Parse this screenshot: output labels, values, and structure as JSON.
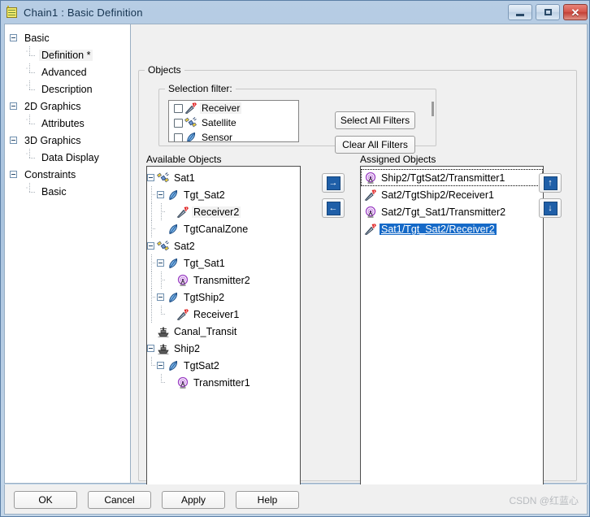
{
  "window": {
    "title": "Chain1 : Basic Definition",
    "icon": "clipboard-icon",
    "minimize_label": "Minimize",
    "maximize_label": "Maximize",
    "close_label": "✕"
  },
  "nav": {
    "items": [
      {
        "label": "Basic",
        "level": 0,
        "expander": true,
        "selected": false
      },
      {
        "label": "Definition *",
        "level": 1,
        "expander": false,
        "selected": true
      },
      {
        "label": "Advanced",
        "level": 1,
        "expander": false,
        "selected": false
      },
      {
        "label": "Description",
        "level": 1,
        "expander": false,
        "selected": false
      },
      {
        "label": "2D Graphics",
        "level": 0,
        "expander": true,
        "selected": false
      },
      {
        "label": "Attributes",
        "level": 1,
        "expander": false,
        "selected": false
      },
      {
        "label": "3D Graphics",
        "level": 0,
        "expander": true,
        "selected": false
      },
      {
        "label": "Data Display",
        "level": 1,
        "expander": false,
        "selected": false
      },
      {
        "label": "Constraints",
        "level": 0,
        "expander": true,
        "selected": false
      },
      {
        "label": "Basic",
        "level": 1,
        "expander": false,
        "selected": false
      }
    ]
  },
  "objects_group": {
    "label": "Objects"
  },
  "selection_filter": {
    "label": "Selection filter:",
    "items": [
      {
        "label": "Receiver",
        "icon": "receiver-icon",
        "checked": false,
        "highlighted": true
      },
      {
        "label": "Satellite",
        "icon": "satellite-icon",
        "checked": false,
        "highlighted": false
      },
      {
        "label": "Sensor",
        "icon": "sensor-icon",
        "checked": false,
        "highlighted": false
      }
    ],
    "select_all_label": "Select All Filters",
    "clear_all_label": "Clear All Filters"
  },
  "available_objects": {
    "label": "Available Objects",
    "items": [
      {
        "label": "Sat1",
        "level": 0,
        "icon": "satellite-icon",
        "expander": true,
        "highlighted": false
      },
      {
        "label": "Tgt_Sat2",
        "level": 1,
        "icon": "sensor-icon",
        "expander": true,
        "highlighted": false
      },
      {
        "label": "Receiver2",
        "level": 2,
        "icon": "receiver-icon",
        "expander": false,
        "highlighted": true
      },
      {
        "label": "TgtCanalZone",
        "level": 1,
        "icon": "sensor-icon",
        "expander": false,
        "highlighted": false
      },
      {
        "label": "Sat2",
        "level": 0,
        "icon": "satellite-icon",
        "expander": true,
        "highlighted": false
      },
      {
        "label": "Tgt_Sat1",
        "level": 1,
        "icon": "sensor-icon",
        "expander": true,
        "highlighted": false
      },
      {
        "label": "Transmitter2",
        "level": 2,
        "icon": "transmitter-icon",
        "expander": false,
        "highlighted": false
      },
      {
        "label": "TgtShip2",
        "level": 1,
        "icon": "sensor-icon",
        "expander": true,
        "highlighted": false
      },
      {
        "label": "Receiver1",
        "level": 2,
        "icon": "receiver-icon",
        "expander": false,
        "highlighted": false
      },
      {
        "label": "Canal_Transit",
        "level": 0,
        "icon": "ship-icon",
        "expander": false,
        "highlighted": false
      },
      {
        "label": "Ship2",
        "level": 0,
        "icon": "ship-icon",
        "expander": true,
        "highlighted": false
      },
      {
        "label": "TgtSat2",
        "level": 1,
        "icon": "sensor-icon",
        "expander": true,
        "highlighted": false
      },
      {
        "label": "Transmitter1",
        "level": 2,
        "icon": "transmitter-icon",
        "expander": false,
        "highlighted": false
      }
    ]
  },
  "assigned_objects": {
    "label": "Assigned Objects",
    "items": [
      {
        "label": "Ship2/TgtSat2/Transmitter1",
        "icon": "transmitter-icon",
        "selected": false,
        "focused": true
      },
      {
        "label": "Sat2/TgtShip2/Receiver1",
        "icon": "receiver-icon",
        "selected": false,
        "focused": false
      },
      {
        "label": "Sat2/Tgt_Sat1/Transmitter2",
        "icon": "transmitter-icon",
        "selected": false,
        "focused": false
      },
      {
        "label": "Sat1/Tgt_Sat2/Receiver2",
        "icon": "receiver-icon",
        "selected": true,
        "focused": false
      }
    ]
  },
  "transfer_buttons": {
    "add": {
      "icon": "arrow-right-icon",
      "glyph": "→"
    },
    "remove": {
      "icon": "arrow-left-icon",
      "glyph": "←"
    },
    "move_up": {
      "icon": "arrow-up-icon",
      "glyph": "↑"
    },
    "move_down": {
      "icon": "arrow-down-icon",
      "glyph": "↓"
    }
  },
  "dialog_buttons": {
    "ok": "OK",
    "cancel": "Cancel",
    "apply": "Apply",
    "help": "Help"
  },
  "watermark": "CSDN @红蓝心",
  "colors": {
    "titlebar_top": "#b7cde4",
    "selection_blue": "#1569c7",
    "button_blue": "#1f5fa8",
    "transmitter_purple": "#9b3fc4",
    "receiver_red": "#e02020",
    "sensor_blue": "#2f6fb5",
    "ship_gray": "#454545"
  }
}
